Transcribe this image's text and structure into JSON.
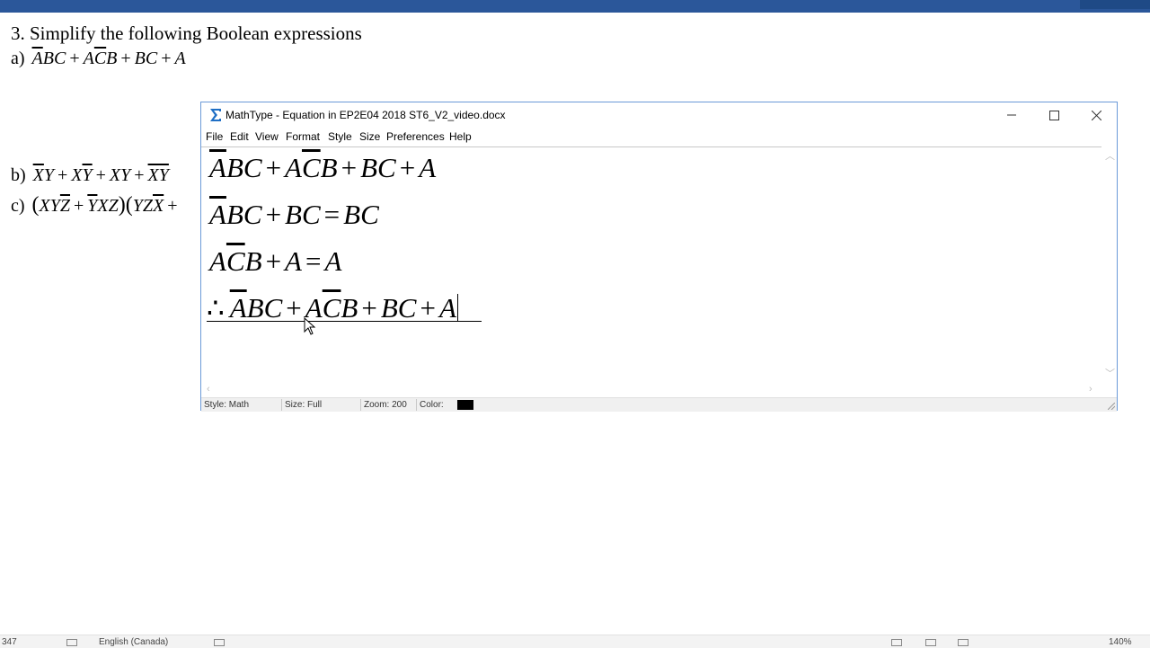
{
  "document": {
    "question_heading": "3. Simplify the following Boolean expressions",
    "part_a_label": "a)",
    "part_b_label": "b)",
    "part_c_label": "c)"
  },
  "mathtype": {
    "title": "MathType - Equation in EP2E04 2018 ST6_V2_video.docx",
    "menu": [
      "File",
      "Edit",
      "View",
      "Format",
      "Style",
      "Size",
      "Preferences",
      "Help"
    ],
    "status": {
      "style": "Style: Math",
      "size": "Size: Full",
      "zoom": "Zoom: 200",
      "color_label": "Color:",
      "color_value": "#000000"
    }
  },
  "word_status": {
    "words": "347",
    "language": "English (Canada)",
    "zoom": "140%"
  },
  "colors": {
    "word_ribbon": "#2b579a",
    "window_border": "#6b9ad8",
    "text": "#000000"
  }
}
